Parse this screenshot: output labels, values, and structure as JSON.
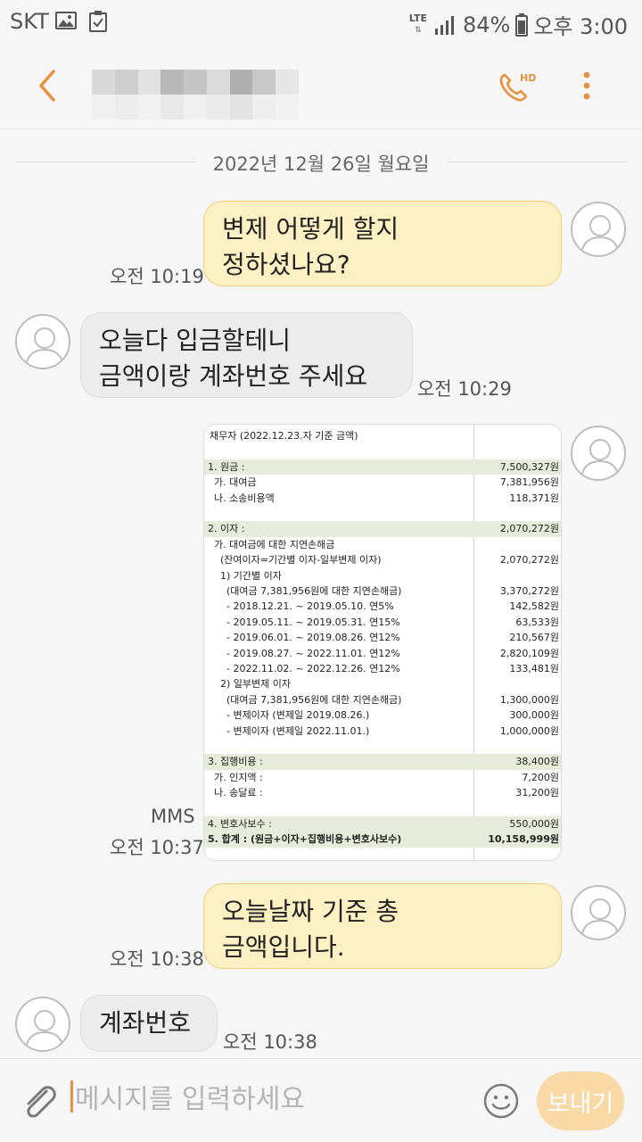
{
  "status": {
    "carrier": "SKT",
    "network": "LTE",
    "battery": "84%",
    "clock": "오후 3:00"
  },
  "header": {
    "contact_name": "",
    "call_badge": "HD"
  },
  "date_divider": "2022년 12월 26일 월요일",
  "messages": [
    {
      "dir": "out",
      "text": "변제 어떻게 할지\n정하셨나요?",
      "time": "오전 10:19"
    },
    {
      "dir": "in",
      "text": "오늘다 입금할테니\n금액이랑 계좌번호 주세요",
      "time": "오전 10:29"
    },
    {
      "dir": "out",
      "type": "mms",
      "tag": "MMS",
      "time": "오전 10:37"
    },
    {
      "dir": "out",
      "text": "오늘날짜 기준 총\n금액입니다.",
      "time": "오전 10:38"
    },
    {
      "dir": "in",
      "text": "계좌번호",
      "time": "오전 10:38"
    }
  ],
  "mms_table": {
    "title": "채무자 (2022.12.23.자 기준 금액)",
    "rows": [
      {
        "label": "1. 원금 :",
        "value": "7,500,327원",
        "shade": true
      },
      {
        "label": "  가. 대여금",
        "value": "7,381,956원"
      },
      {
        "label": "  나. 소송비용액",
        "value": "118,371원"
      },
      {
        "label": "2. 이자 :",
        "value": "2,070,272원",
        "shade": true
      },
      {
        "label": "  가. 대여금에 대한 지연손해금",
        "value": ""
      },
      {
        "label": "    (잔여이자=기간별 이자-일부변제 이자)",
        "value": "2,070,272원"
      },
      {
        "label": "    1) 기간별 이자",
        "value": ""
      },
      {
        "label": "      (대여금 7,381,956원에 대한 지연손해금)",
        "value": "3,370,272원"
      },
      {
        "label": "      - 2018.12.21. ~ 2019.05.10. 연5%",
        "value": "142,582원"
      },
      {
        "label": "      - 2019.05.11. ~ 2019.05.31. 연15%",
        "value": "63,533원"
      },
      {
        "label": "      - 2019.06.01. ~ 2019.08.26. 연12%",
        "value": "210,567원"
      },
      {
        "label": "      - 2019.08.27. ~ 2022.11.01. 연12%",
        "value": "2,820,109원"
      },
      {
        "label": "      - 2022.11.02. ~ 2022.12.26. 연12%",
        "value": "133,481원"
      },
      {
        "label": "    2) 일부변제 이자",
        "value": ""
      },
      {
        "label": "      (대여금 7,381,956원에 대한 지연손해금)",
        "value": "1,300,000원"
      },
      {
        "label": "      - 변제이자 (변제일 2019.08.26.)",
        "value": "300,000원"
      },
      {
        "label": "      - 변제이자 (변제일 2022.11.01.)",
        "value": "1,000,000원"
      },
      {
        "label": "3. 집행비용 :",
        "value": "38,400원",
        "shade": true
      },
      {
        "label": "  가. 인지액 :",
        "value": "7,200원"
      },
      {
        "label": "  나. 송달료 :",
        "value": "31,200원"
      },
      {
        "label": "4. 변호사보수 :",
        "value": "550,000원",
        "shade": true
      },
      {
        "label": "5. 합계 : (원금+이자+집행비용+변호사보수)",
        "value": "10,158,999원",
        "shade": true,
        "bold": true
      }
    ]
  },
  "composer": {
    "placeholder": "메시지를 입력하세요",
    "send_label": "보내기"
  },
  "icons": {
    "back": "chevron-left-icon",
    "call": "phone-hd-icon",
    "more": "more-vertical-icon",
    "attach": "paperclip-icon",
    "emoji": "smiley-icon",
    "avatar": "person-icon"
  },
  "colors": {
    "accent": "#e8903d",
    "out_bubble": "#fdf0c2",
    "in_bubble": "#ececec",
    "send_disabled": "#f9d9a5"
  }
}
